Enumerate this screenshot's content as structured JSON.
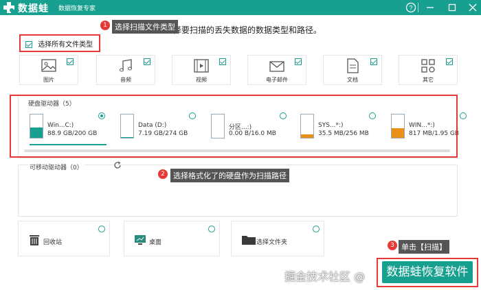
{
  "app": {
    "name": "数据蛙",
    "subtitle": "数据恢复专家"
  },
  "colors": {
    "brand": "#17a08f",
    "annotation_red": "#e53935",
    "orange": "#e8901a"
  },
  "prompt": "选择要扫描的丢失数据的数据类型和路径。",
  "annotations": [
    {
      "num": "1",
      "text": "选择扫描文件类型"
    },
    {
      "num": "2",
      "text": "选择格式化了的硬盘作为扫描路径"
    },
    {
      "num": "3",
      "text": "单击【扫描】"
    }
  ],
  "select_all": "选择所有文件类型",
  "file_types": [
    {
      "label": "图片",
      "icon": "image-icon"
    },
    {
      "label": "音频",
      "icon": "audio-icon"
    },
    {
      "label": "视频",
      "icon": "video-icon"
    },
    {
      "label": "电子邮件",
      "icon": "email-icon"
    },
    {
      "label": "文档",
      "icon": "document-icon"
    },
    {
      "label": "其它",
      "icon": "other-icon"
    }
  ],
  "hard_drives": {
    "title": "硬盘驱动器（5）",
    "items": [
      {
        "name": "Win...C:)",
        "size": "88.9 GB/200 GB",
        "selected": true,
        "fill": 0.44,
        "color": "#17a08f"
      },
      {
        "name": "Data (D:)",
        "size": "7.19 GB/274 GB",
        "selected": false,
        "fill": 0.03,
        "color": "#17a08f"
      },
      {
        "name": "分区...:)",
        "size": "0.00  B/16.0 MB",
        "selected": false,
        "fill": 0.0,
        "color": "#e8901a"
      },
      {
        "name": "SYS...*:)",
        "size": "35.5 MB/256 MB",
        "selected": false,
        "fill": 0.14,
        "color": "#e8901a"
      },
      {
        "name": "WIN...*:)",
        "size": "817 MB/1.95 GB",
        "selected": false,
        "fill": 0.42,
        "color": "#e8901a"
      }
    ]
  },
  "removable": {
    "title": "可移动驱动器（0）"
  },
  "locations": [
    {
      "label": "回收站",
      "icon": "recycle-bin-icon"
    },
    {
      "label": "桌面",
      "icon": "desktop-icon"
    },
    {
      "label": "选择文件夹",
      "icon": "folder-icon"
    }
  ],
  "scan_button": "数据蛙恢复软件",
  "watermark": "掘金技术社区 @"
}
